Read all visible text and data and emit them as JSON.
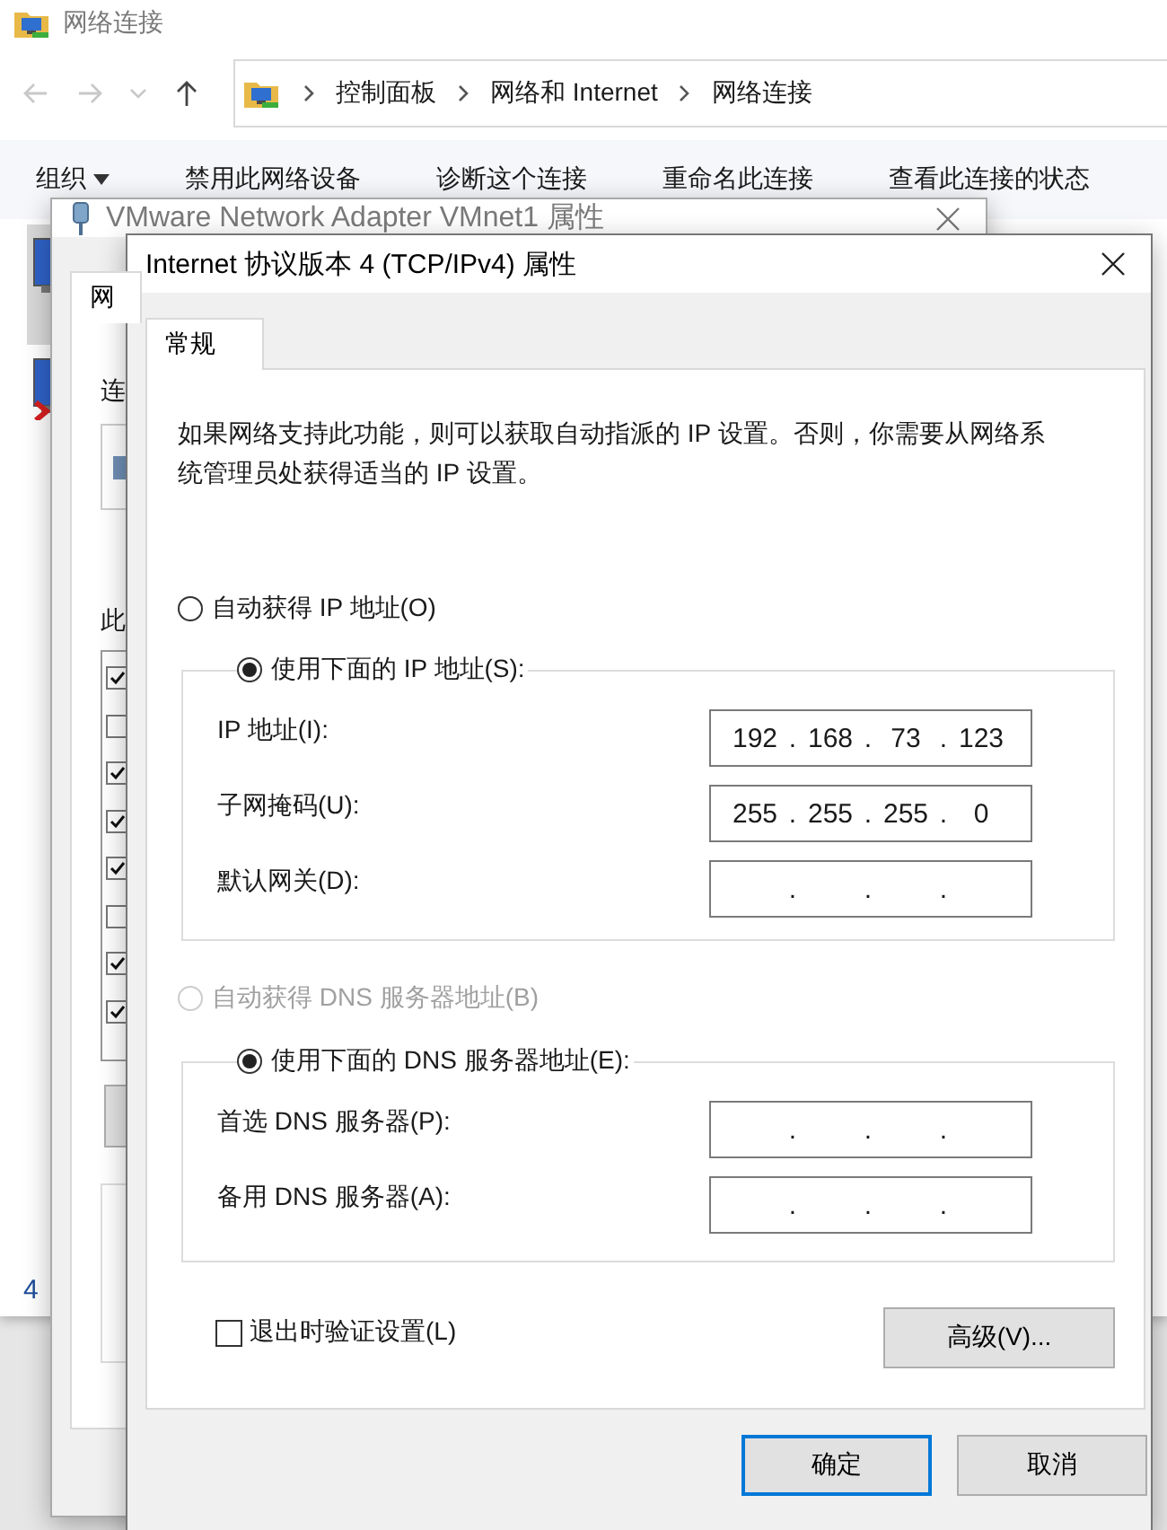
{
  "explorer": {
    "title": "网络连接",
    "breadcrumbs": [
      "控制面板",
      "网络和 Internet",
      "网络连接"
    ],
    "toolbar": [
      {
        "label": "组织",
        "kind": "menu"
      },
      {
        "label": "禁用此网络设备",
        "kind": "action"
      },
      {
        "label": "诊断这个连接",
        "kind": "action"
      },
      {
        "label": "重命名此连接",
        "kind": "action"
      },
      {
        "label": "查看此连接的状态",
        "kind": "action"
      }
    ],
    "adapters": [
      {
        "selected": true,
        "disabled": false
      },
      {
        "selected": false,
        "disabled": true
      }
    ],
    "status_bar": {
      "count": "4"
    }
  },
  "adapter_dialog": {
    "title": "VMware Network Adapter VMnet1 属性",
    "active": false,
    "tabs": [
      {
        "label": "网",
        "selected": true
      }
    ],
    "connect_label": "连",
    "components_label": "此",
    "components": [
      {
        "checked": true
      },
      {
        "checked": false
      },
      {
        "checked": true
      },
      {
        "checked": true
      },
      {
        "checked": true
      },
      {
        "checked": false
      },
      {
        "checked": true
      },
      {
        "checked": true
      }
    ]
  },
  "ipv4_dialog": {
    "title": "Internet 协议版本 4 (TCP/IPv4) 属性",
    "active": true,
    "tabs": [
      {
        "label": "常规",
        "selected": true
      }
    ],
    "description": "如果网络支持此功能，则可以获取自动指派的 IP 设置。否则，你需要从网络系统管理员处获得适当的 IP 设置。",
    "ip_mode": [
      {
        "label": "自动获得 IP 地址(O)",
        "selected": false,
        "disabled": false
      },
      {
        "label": "使用下面的 IP 地址(S):",
        "selected": true,
        "disabled": false
      }
    ],
    "ip_fields": [
      {
        "label": "IP 地址(I):",
        "segments": [
          "192",
          "168",
          "73",
          "123"
        ],
        "separators": [
          ".",
          ".",
          "."
        ]
      },
      {
        "label": "子网掩码(U):",
        "segments": [
          "255",
          "255",
          "255",
          "0"
        ],
        "separators": [
          ".",
          ".",
          "."
        ]
      },
      {
        "label": "默认网关(D):",
        "separators": [
          ".",
          ".",
          "."
        ]
      }
    ],
    "dns_mode": [
      {
        "label": "自动获得 DNS 服务器地址(B)",
        "selected": false,
        "disabled": true
      },
      {
        "label": "使用下面的 DNS 服务器地址(E):",
        "selected": true,
        "disabled": false
      }
    ],
    "dns_fields": [
      {
        "label": "首选 DNS 服务器(P):",
        "separators": [
          ".",
          ".",
          "."
        ]
      },
      {
        "label": "备用 DNS 服务器(A):",
        "separators": [
          ".",
          ".",
          "."
        ]
      }
    ],
    "validate_checkbox": {
      "label": "退出时验证设置(L)",
      "checked": false
    },
    "advanced_button": "高级(V)...",
    "buttons": [
      {
        "label": "确定",
        "default": true
      },
      {
        "label": "取消",
        "default": false
      }
    ]
  }
}
